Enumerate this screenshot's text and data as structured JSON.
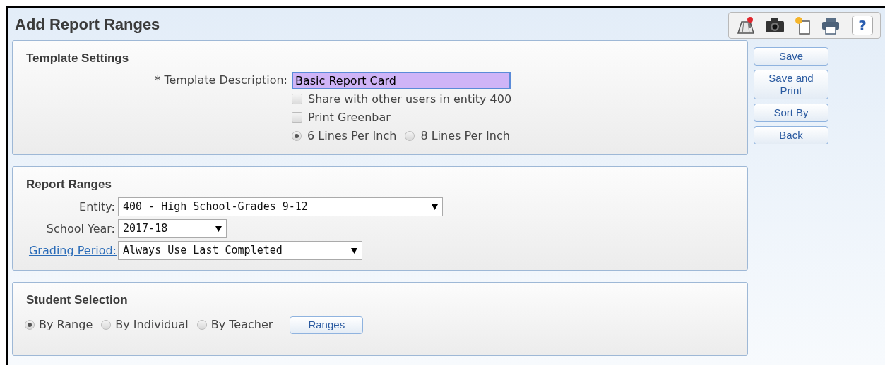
{
  "title": "Add Report Ranges",
  "toolbar": [
    {
      "kind": "map"
    },
    {
      "kind": "camera"
    },
    {
      "kind": "new-page"
    },
    {
      "kind": "print"
    },
    {
      "kind": "help",
      "label": "?"
    }
  ],
  "template_settings": {
    "heading": "Template Settings",
    "description_label": "* Template Description:",
    "description_value": "Basic Report Card",
    "focused": true,
    "checkboxes": [
      {
        "label": "Share with other users in entity 400",
        "checked": false
      },
      {
        "label": "Print Greenbar",
        "checked": false
      }
    ],
    "line_options": [
      {
        "label": "6 Lines Per Inch",
        "selected": true
      },
      {
        "label": "8 Lines Per Inch",
        "selected": false
      }
    ]
  },
  "report_ranges": {
    "heading": "Report Ranges",
    "fields": [
      {
        "label": "Entity:",
        "value": "400 - High School-Grades 9-12",
        "link": false
      },
      {
        "label": "School Year:",
        "value": "2017-18",
        "link": false
      },
      {
        "label": "Grading Period:",
        "value": "Always Use Last Completed",
        "link": true
      }
    ]
  },
  "student_selection": {
    "heading": "Student Selection",
    "options": [
      {
        "label": "By Range",
        "selected": true
      },
      {
        "label": "By Individual",
        "selected": false
      },
      {
        "label": "By Teacher",
        "selected": false
      }
    ],
    "button": "Ranges"
  },
  "actions": [
    {
      "label": "Save",
      "underline_first": true
    },
    {
      "label": "Save and Print",
      "underline_first": false
    },
    {
      "label": "Sort By",
      "underline_first": false
    },
    {
      "label": "Back",
      "underline_first": true
    }
  ]
}
